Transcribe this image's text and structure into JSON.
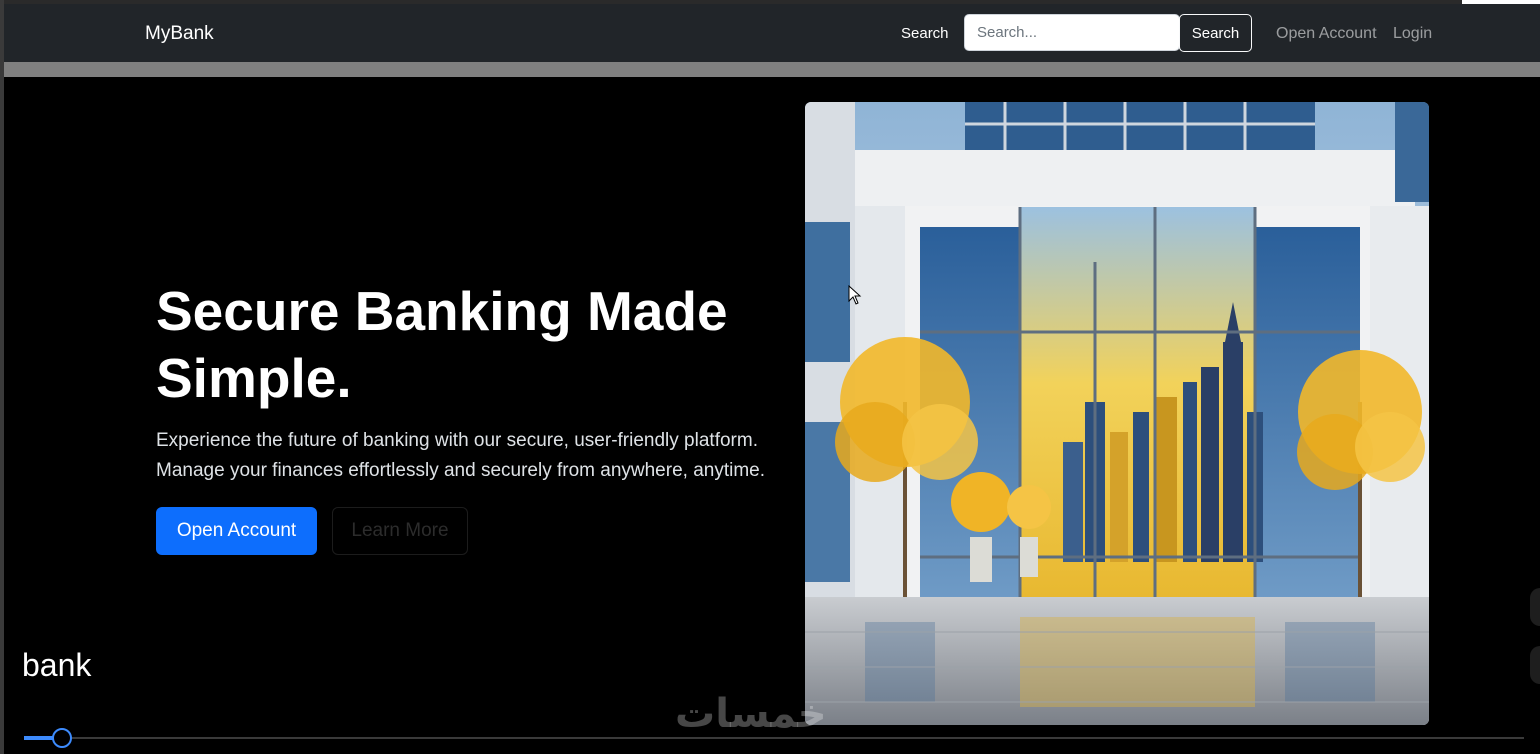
{
  "navbar": {
    "brand": "MyBank",
    "search_label": "Search",
    "search_placeholder": "Search...",
    "search_button": "Search",
    "links": [
      "Open Account",
      "Login"
    ]
  },
  "hero": {
    "title": "Secure Banking Made Simple.",
    "description": "Experience the future of banking with our secure, user-friendly platform. Manage your finances effortlessly and securely from anywhere, anytime.",
    "primary_button": "Open Account",
    "secondary_button": "Learn More",
    "image_icon": "bank-building-illustration"
  },
  "video_overlay": {
    "caption": "bank",
    "watermark": "خمسات",
    "progress": 0.02
  },
  "colors": {
    "navbar_bg": "#212529",
    "primary": "#0d6efd",
    "background": "#000000",
    "band": "#808080"
  }
}
